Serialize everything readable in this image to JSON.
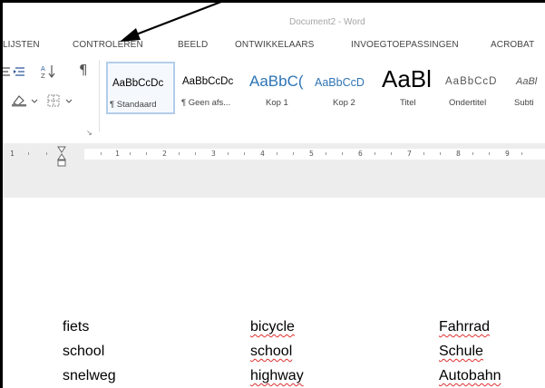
{
  "window": {
    "document_title": "Document2 - Word"
  },
  "tabs": [
    {
      "label": "LIJSTEN"
    },
    {
      "label": "CONTROLEREN"
    },
    {
      "label": "BEELD"
    },
    {
      "label": "ONTWIKKELAARS"
    },
    {
      "label": "INVOEGTOEPASSINGEN"
    },
    {
      "label": "ACROBAT"
    }
  ],
  "ribbon": {
    "styles": [
      {
        "preview": "AaBbCcDc",
        "name": "¶ Standaard",
        "selected": true
      },
      {
        "preview": "AaBbCcDc",
        "name": "¶ Geen afs..."
      },
      {
        "preview": "AaBbC(",
        "name": "Kop 1"
      },
      {
        "preview": "AaBbCcD",
        "name": "Kop 2"
      },
      {
        "preview": "AaBl",
        "name": "Titel"
      },
      {
        "preview": "AaBbCcD",
        "name": "Ondertitel"
      },
      {
        "preview": "AaBl",
        "name": "Subti"
      }
    ],
    "icons": {
      "paragraph_mark": "¶",
      "sort": "sort-icon",
      "indent": "indent-icon",
      "shading": "shading-icon",
      "borders": "borders-icon"
    }
  },
  "ruler": {
    "numbers": [
      "1",
      "1",
      "2",
      "3",
      "4",
      "5",
      "6",
      "7",
      "8",
      "9"
    ]
  },
  "document": {
    "rows": [
      [
        "fiets",
        "bicycle",
        "Fahrrad"
      ],
      [
        "school",
        "school",
        "Schule"
      ],
      [
        "snelweg",
        "highway",
        "Autobahn"
      ]
    ]
  },
  "colors": {
    "accent": "#2b579a",
    "selected_border": "#b3cde8",
    "spell_error": "#e03030"
  }
}
